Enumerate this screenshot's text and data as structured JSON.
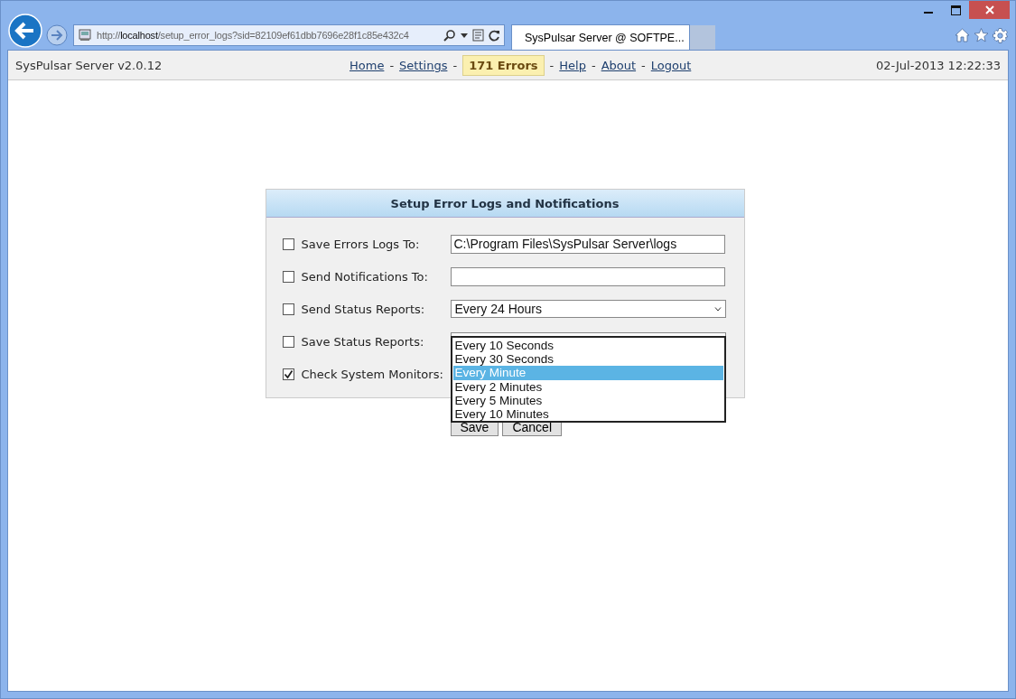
{
  "browser": {
    "url": "http://**localhost**/setup_error_logs?sid=82109ef61dbb7696e28f1c85e432c4",
    "tabs": [
      {
        "title": "SysPulsar Server @ SOFTPE...",
        "selected": true
      }
    ]
  },
  "header": {
    "app_title": "SysPulsar Server v2.0.12",
    "datetime": "02-Jul-2013 12:22:33",
    "nav": [
      {
        "label": "Home",
        "kind": "link"
      },
      {
        "label": "Settings",
        "kind": "link",
        "separator": "-"
      },
      {
        "label": "171 Errors",
        "kind": "badge",
        "separator": "-"
      },
      {
        "label": "Help",
        "kind": "link",
        "separator": "-"
      },
      {
        "label": "About",
        "kind": "link",
        "separator": "-"
      },
      {
        "label": "Logout",
        "kind": "link",
        "separator": "-"
      }
    ]
  },
  "form": {
    "title": "Setup Error Logs and Notifications",
    "rows": [
      {
        "label": "Save Errors Logs To:",
        "checked": false,
        "field": {
          "kind": "text",
          "value": "C:\\Program Files\\SysPulsar Server\\logs"
        }
      },
      {
        "label": "Send Notifications To:",
        "checked": false,
        "field": {
          "kind": "text"
        }
      },
      {
        "label": "Send Status Reports:",
        "checked": false,
        "field": {
          "kind": "select",
          "value": "Every 24 Hours"
        }
      },
      {
        "label": "Save Status Reports:",
        "checked": false,
        "field": {
          "kind": "select"
        }
      },
      {
        "label": "Check System Monitors:",
        "checked": true
      }
    ],
    "dropdown": [
      {
        "label": "Every 10 Seconds",
        "selected": false
      },
      {
        "label": "Every 30 Seconds",
        "selected": false
      },
      {
        "label": "Every Minute",
        "selected": true
      },
      {
        "label": "Every 2 Minutes",
        "selected": false
      },
      {
        "label": "Every 5 Minutes",
        "selected": false
      },
      {
        "label": "Every 10 Minutes",
        "selected": false
      }
    ],
    "buttons": [
      {
        "label": "Save"
      },
      {
        "label": "Cancel"
      }
    ]
  }
}
